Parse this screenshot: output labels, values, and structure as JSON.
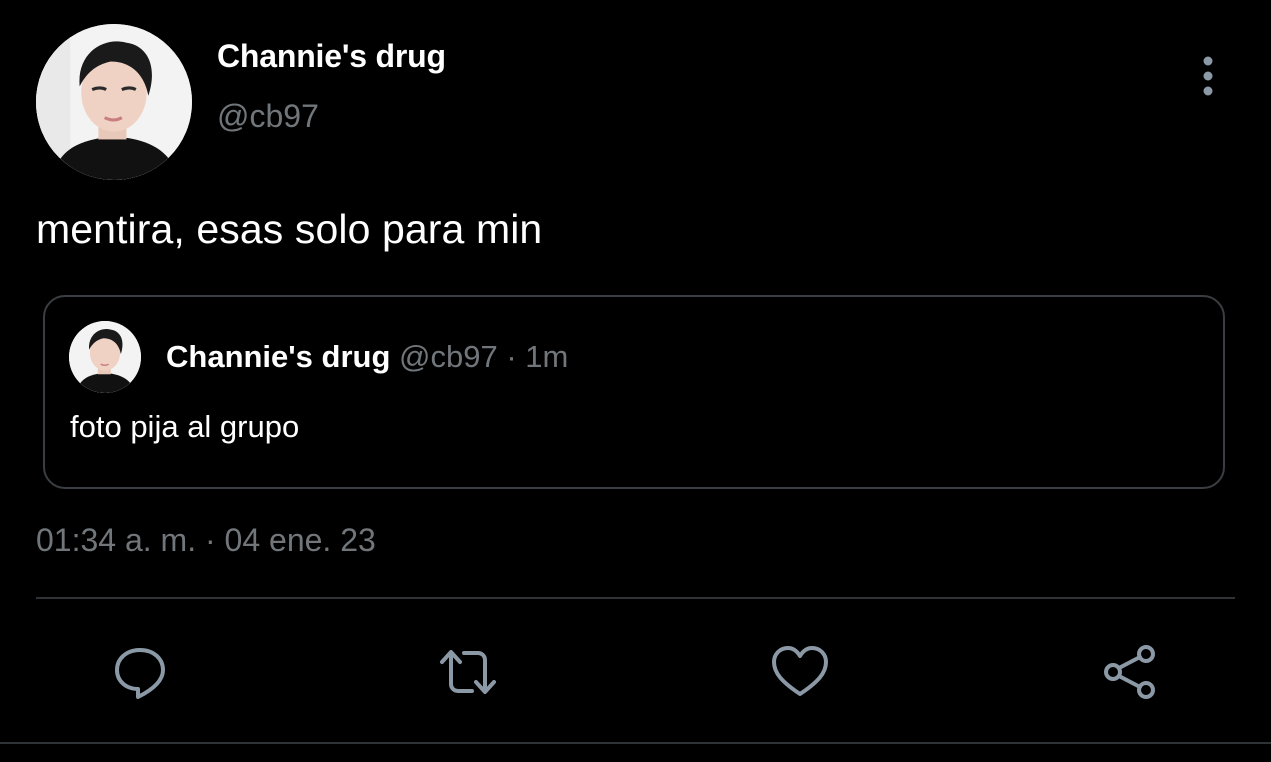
{
  "tweet": {
    "author": {
      "display_name": "Channie's drug",
      "handle": "@cb97",
      "avatar": "profile-photo"
    },
    "text": "mentira, esas solo para min",
    "timestamp": "01:34 a. m.",
    "separator": "·",
    "date": "04 ene. 23",
    "more_icon": "more-vertical-icon"
  },
  "quoted_tweet": {
    "display_name": "Channie's drug",
    "handle": "@cb97",
    "separator": "·",
    "time": "1m",
    "text": "foto pija al grupo"
  },
  "actions": [
    {
      "name": "reply",
      "icon": "reply-icon"
    },
    {
      "name": "retweet",
      "icon": "retweet-icon"
    },
    {
      "name": "like",
      "icon": "heart-icon"
    },
    {
      "name": "share",
      "icon": "share-icon"
    }
  ],
  "colors": {
    "background": "#000000",
    "primary_text": "#ffffff",
    "secondary_text": "#71767b",
    "border": "#3a3d41",
    "icon": "#8b98a5"
  }
}
